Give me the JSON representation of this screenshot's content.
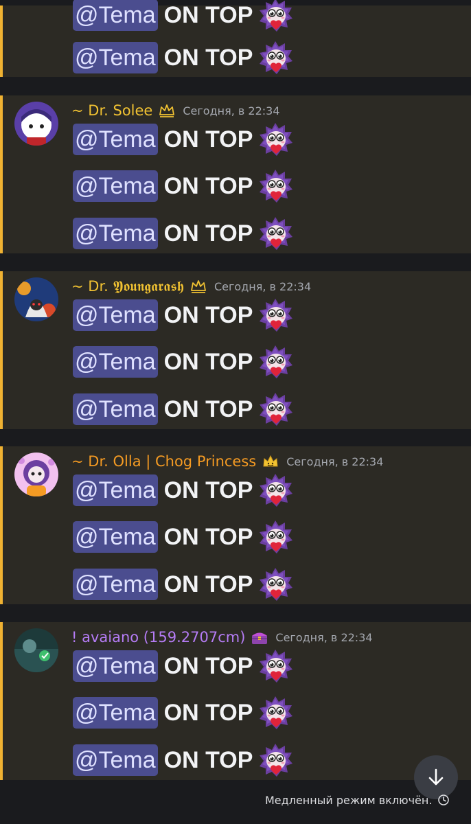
{
  "message_text": {
    "mention": "@Tema",
    "text": "ON TOP"
  },
  "colors": {
    "accent_bar": "#f0b232",
    "mention_bg": "#4b4d8f",
    "name_yellow": "#f1c232",
    "name_orange": "#f59b23",
    "name_purple": "#b57cf5"
  },
  "top_partial": {
    "messages": [
      {
        "mention": "@Tema",
        "text": "ON TOP",
        "emoji": "chog-heart-emoji"
      },
      {
        "mention": "@Tema",
        "text": "ON TOP",
        "emoji": "chog-heart-emoji"
      }
    ]
  },
  "groups": [
    {
      "username": "~ Dr.  Solee",
      "badge": "crown-icon",
      "timestamp": "Сегодня, в 22:34",
      "messages": [
        {
          "mention": "@Tema",
          "text": "ON TOP",
          "emoji": "chog-heart-emoji"
        },
        {
          "mention": "@Tema",
          "text": "ON TOP",
          "emoji": "chog-heart-emoji"
        },
        {
          "mention": "@Tema",
          "text": "ON TOP",
          "emoji": "chog-heart-emoji"
        }
      ]
    },
    {
      "username": "~ Dr. 𝖄𝖔𝖚𝖓𝖌𝖆𝖗𝖆𝖘𝖍",
      "badge": "crown-icon",
      "timestamp": "Сегодня, в 22:34",
      "messages": [
        {
          "mention": "@Tema",
          "text": "ON TOP",
          "emoji": "chog-heart-emoji"
        },
        {
          "mention": "@Tema",
          "text": "ON TOP",
          "emoji": "chog-heart-emoji"
        },
        {
          "mention": "@Tema",
          "text": "ON TOP",
          "emoji": "chog-heart-emoji"
        }
      ]
    },
    {
      "username": "~ Dr. Olla | Chog Princess",
      "badge": "crown-smile-icon",
      "timestamp": "Сегодня, в 22:34",
      "messages": [
        {
          "mention": "@Tema",
          "text": "ON TOP",
          "emoji": "chog-heart-emoji"
        },
        {
          "mention": "@Tema",
          "text": "ON TOP",
          "emoji": "chog-heart-emoji"
        },
        {
          "mention": "@Tema",
          "text": "ON TOP",
          "emoji": "chog-heart-emoji"
        }
      ]
    },
    {
      "username": "! avaiano (159.2707cm)",
      "badge": "treasure-chest-icon",
      "timestamp": "Сегодня, в 22:34",
      "messages": [
        {
          "mention": "@Tema",
          "text": "ON TOP",
          "emoji": "chog-heart-emoji"
        },
        {
          "mention": "@Tema",
          "text": "ON TOP",
          "emoji": "chog-heart-emoji"
        },
        {
          "mention": "@Tema",
          "text": "ON TOP",
          "emoji": "chog-heart-emoji"
        }
      ]
    }
  ],
  "footer": {
    "slowmode_text": "Медленный режим включён.",
    "slowmode_icon": "clock-icon",
    "scroll_button_icon": "arrow-down-icon"
  }
}
